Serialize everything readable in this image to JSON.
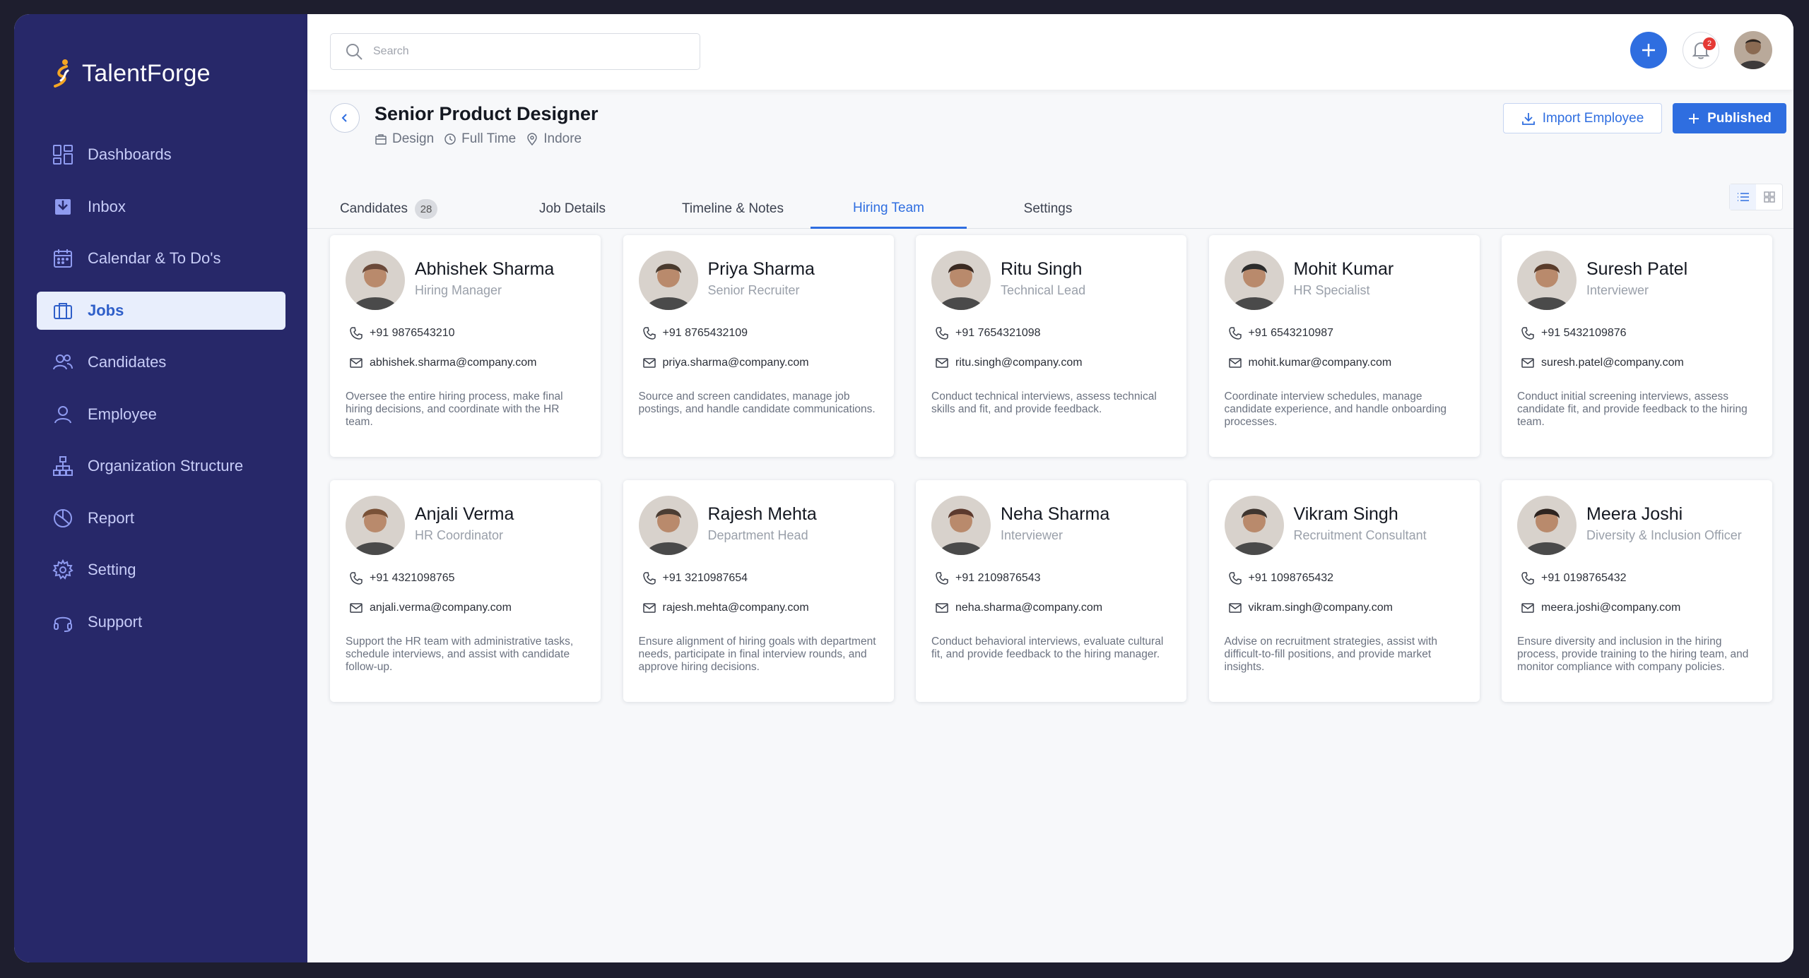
{
  "app": {
    "name": "TalentForge"
  },
  "sidebar": {
    "items": [
      {
        "label": "Dashboards",
        "icon": "dashboard-icon",
        "active": false
      },
      {
        "label": "Inbox",
        "icon": "inbox-icon",
        "active": false
      },
      {
        "label": "Calendar & To Do's",
        "icon": "calendar-icon",
        "active": false
      },
      {
        "label": "Jobs",
        "icon": "briefcase-icon",
        "active": true
      },
      {
        "label": "Candidates",
        "icon": "users-icon",
        "active": false
      },
      {
        "label": "Employee",
        "icon": "user-icon",
        "active": false
      },
      {
        "label": "Organization Structure",
        "icon": "org-chart-icon",
        "active": false
      },
      {
        "label": "Report",
        "icon": "pie-chart-icon",
        "active": false
      },
      {
        "label": "Setting",
        "icon": "gear-icon",
        "active": false
      },
      {
        "label": "Support",
        "icon": "headset-icon",
        "active": false
      }
    ]
  },
  "topbar": {
    "search_placeholder": "Search",
    "notifications_count": "2"
  },
  "job": {
    "title": "Senior Product Designer",
    "department": "Design",
    "employment_type": "Full Time",
    "location": "Indore"
  },
  "actions": {
    "import_label": "Import Employee",
    "published_label": "Published"
  },
  "tabs": [
    {
      "label": "Candidates",
      "count": "28",
      "active": false
    },
    {
      "label": "Job Details",
      "active": false
    },
    {
      "label": "Timeline & Notes",
      "active": false
    },
    {
      "label": "Hiring Team",
      "active": true
    },
    {
      "label": "Settings",
      "active": false
    }
  ],
  "team": [
    {
      "name": "Abhishek Sharma",
      "role": "Hiring Manager",
      "phone": "+91 9876543210",
      "email": "abhishek.sharma@company.com",
      "description": "Oversee the entire hiring process, make final hiring decisions, and coordinate with the HR team.",
      "avatar_color": "#6b4a3a"
    },
    {
      "name": "Priya Sharma",
      "role": "Senior Recruiter",
      "phone": "+91 8765432109",
      "email": "priya.sharma@company.com",
      "description": "Source and screen candidates, manage job postings, and handle candidate communications.",
      "avatar_color": "#4a3b2f"
    },
    {
      "name": "Ritu Singh",
      "role": "Technical Lead",
      "phone": "+91 7654321098",
      "email": "ritu.singh@company.com",
      "description": "Conduct technical interviews, assess technical skills and fit, and provide feedback.",
      "avatar_color": "#3a2a22"
    },
    {
      "name": "Mohit Kumar",
      "role": "HR Specialist",
      "phone": "+91 6543210987",
      "email": "mohit.kumar@company.com",
      "description": "Coordinate interview schedules, manage candidate experience, and handle onboarding processes.",
      "avatar_color": "#2c2c2c"
    },
    {
      "name": "Suresh Patel",
      "role": "Interviewer",
      "phone": "+91 5432109876",
      "email": "suresh.patel@company.com",
      "description": "Conduct initial screening interviews, assess candidate fit, and provide feedback to the hiring team.",
      "avatar_color": "#5a3d2c"
    },
    {
      "name": "Anjali Verma",
      "role": "HR Coordinator",
      "phone": "+91 4321098765",
      "email": "anjali.verma@company.com",
      "description": "Support the HR team with administrative tasks, schedule interviews, and assist with candidate follow-up.",
      "avatar_color": "#7a5238"
    },
    {
      "name": "Rajesh Mehta",
      "role": "Department Head",
      "phone": "+91 3210987654",
      "email": "rajesh.mehta@company.com",
      "description": "Ensure alignment of hiring goals with department needs, participate in final interview rounds, and approve hiring decisions.",
      "avatar_color": "#4b3d33"
    },
    {
      "name": "Neha Sharma",
      "role": "Interviewer",
      "phone": "+91 2109876543",
      "email": "neha.sharma@company.com",
      "description": "Conduct behavioral interviews, evaluate cultural fit, and provide feedback to the hiring manager.",
      "avatar_color": "#5c3a2e"
    },
    {
      "name": "Vikram Singh",
      "role": "Recruitment Consultant",
      "phone": "+91 1098765432",
      "email": "vikram.singh@company.com",
      "description": "Advise on recruitment strategies, assist with difficult-to-fill positions, and provide market insights.",
      "avatar_color": "#3f3630"
    },
    {
      "name": "Meera Joshi",
      "role": "Diversity & Inclusion Officer",
      "phone": "+91 0198765432",
      "email": "meera.joshi@company.com",
      "description": "Ensure diversity and inclusion in the hiring process, provide training to the hiring team, and monitor compliance with company policies.",
      "avatar_color": "#2e2420"
    }
  ],
  "colors": {
    "sidebar_bg": "#272869",
    "accent": "#2f6ee0",
    "active_nav_bg": "#e8eefc"
  }
}
